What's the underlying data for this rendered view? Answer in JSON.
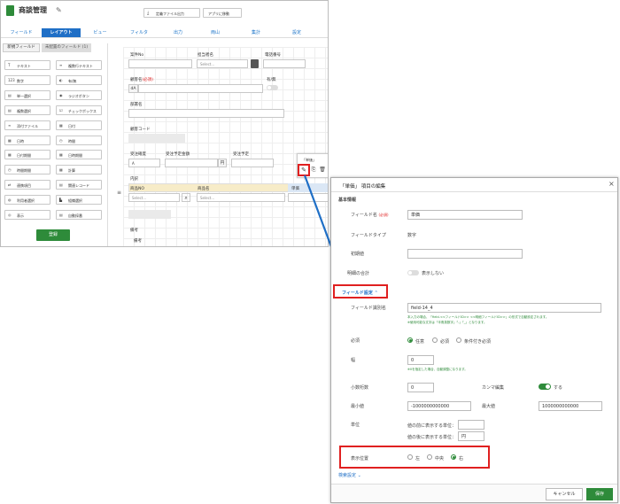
{
  "app": {
    "title": "商談管理"
  },
  "toolbar": {
    "export_def": "定義ファイル出力",
    "go_app": "アプリに移動"
  },
  "tabs": [
    {
      "label": "フィールド"
    },
    {
      "label": "レイアウト"
    },
    {
      "label": "ビュー"
    },
    {
      "label": "フィルタ"
    },
    {
      "label": "出力"
    },
    {
      "label": "両山"
    },
    {
      "label": "集計"
    },
    {
      "label": "設定"
    }
  ],
  "palette": {
    "tab_new": "新規フィールド",
    "tab_unplaced": "未配置のフィールド (1)",
    "fields": [
      {
        "label": "テキスト",
        "icon": "T"
      },
      {
        "label": "複数行テキスト",
        "icon": "≡"
      },
      {
        "label": "数字",
        "icon": "123"
      },
      {
        "label": "有/無",
        "icon": "◐"
      },
      {
        "label": "単一選択",
        "icon": "▤"
      },
      {
        "label": "ラジオボタン",
        "icon": "◉"
      },
      {
        "label": "複数選択",
        "icon": "▤"
      },
      {
        "label": "チェックボックス",
        "icon": "☑"
      },
      {
        "label": "添付ファイル",
        "icon": "∞"
      },
      {
        "label": "日付",
        "icon": "▦"
      },
      {
        "label": "日時",
        "icon": "▦"
      },
      {
        "label": "時間",
        "icon": "◷"
      },
      {
        "label": "日付期間",
        "icon": "▦"
      },
      {
        "label": "日時期間",
        "icon": "▦"
      },
      {
        "label": "時間期間",
        "icon": "◷"
      },
      {
        "label": "計算",
        "icon": "▦"
      },
      {
        "label": "連携項目",
        "icon": "⇄"
      },
      {
        "label": "関連レコード",
        "icon": "▤"
      },
      {
        "label": "利用者選択",
        "icon": "◍"
      },
      {
        "label": "組織選択",
        "icon": "▙"
      },
      {
        "label": "表示",
        "icon": "◎"
      },
      {
        "label": "自動採番",
        "icon": "▤"
      }
    ],
    "register": "登録"
  },
  "form": {
    "case_no": "案件No",
    "staff_name": "担当者名",
    "phone": "電話番号",
    "select_placeholder": "Select...",
    "customer": "顧客名",
    "required": "(必須)",
    "customer_value": "dA",
    "flag": "有/無",
    "dept": "部署名",
    "customer_code": "顧客コード",
    "order_rank": "受注確度",
    "rank_value": "A",
    "expected_amount": "受注予定金額",
    "yen": "円",
    "expected_date": "受注予定",
    "detail": "内訳",
    "product_no": "商品NO",
    "product_name": "商品名",
    "unit_price": "単価",
    "popup_title": "「単価」",
    "remarks": "備考",
    "memo": "備考"
  },
  "dialog": {
    "title": "「単価」 項目の編集",
    "basic": "基本情報",
    "field_name_label": "フィールド名",
    "required": "(必須)",
    "field_name_value": "単価",
    "field_type_label": "フィールドタイプ",
    "field_type_value": "数字",
    "initial_label": "初期値",
    "total_label": "明細の合計",
    "total_value": "表示しない",
    "field_settings": "フィールド設定",
    "field_id_label": "フィールド識別名",
    "field_id_value": "field-14_4",
    "field_id_note1": "本入力の場合、「field-<<フィールドID>> <<明細フィールドID>>」の形式で自動設定されます。",
    "field_id_note2": "※使用可能な文字は「半角英数字」「-」「_」となります。",
    "required_label": "必須",
    "opt_any": "任意",
    "opt_required": "必須",
    "opt_conditional": "条件付き必須",
    "width_label": "幅",
    "width_value": "0",
    "width_note": "※0を指定した場合、自動調整になります。",
    "decimal_label": "小数桁数",
    "decimal_value": "0",
    "comma_label": "カンマ編集",
    "comma_value": "する",
    "min_label": "最小値",
    "min_value": "-1000000000000",
    "max_label": "最大値",
    "max_value": "1000000000000",
    "unit_label": "単位",
    "unit_before": "値の前に表示する単位：",
    "unit_after": "値の後に表示する単位：",
    "unit_after_value": "円",
    "pos_label": "表示位置",
    "pos_left": "左",
    "pos_center": "中央",
    "pos_right": "右",
    "search_settings": "検索設定",
    "cancel": "キャンセル",
    "save": "保存"
  },
  "colors": {
    "accent": "#1f6fc6",
    "save": "#2e8b3a",
    "highlight": "#e02020"
  }
}
